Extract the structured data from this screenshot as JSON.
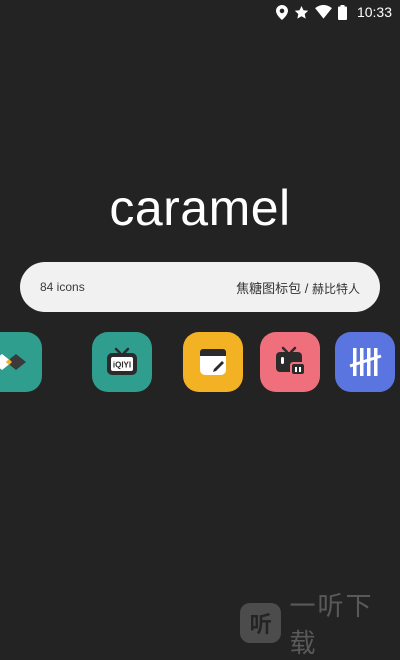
{
  "status_bar": {
    "time": "10:33",
    "icons": [
      "location-icon",
      "star-icon",
      "wifi-icon",
      "battery-icon"
    ]
  },
  "app": {
    "title": "caramel"
  },
  "info": {
    "icon_count": "84 icons",
    "pack_name": "焦糖图标包 / ",
    "author": "赫比特人"
  },
  "icons": [
    {
      "name": "maps-app-icon",
      "color": "#2f9e8f"
    },
    {
      "name": "iqiyi-app-icon",
      "color": "#2f9e8f",
      "label": "iQIYI"
    },
    {
      "name": "notes-app-icon",
      "color": "#f2b224"
    },
    {
      "name": "bilibili-app-icon",
      "color": "#ef6f7d"
    },
    {
      "name": "tally-app-icon",
      "color": "#5b75e0"
    }
  ],
  "watermark": {
    "logo_text": "听",
    "text": "一听下载"
  }
}
